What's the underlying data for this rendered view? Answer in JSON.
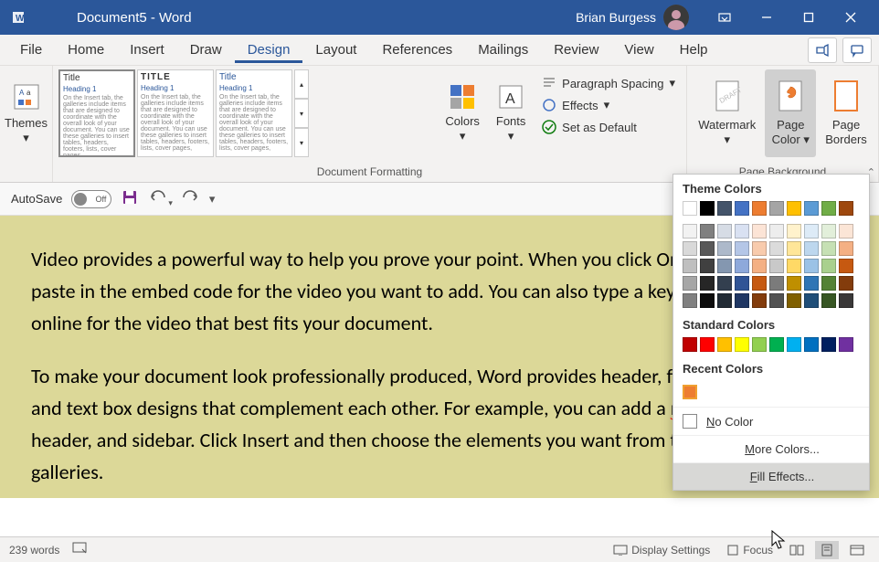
{
  "titlebar": {
    "title": "Document5  -  Word",
    "user": "Brian Burgess"
  },
  "tabs": {
    "items": [
      "File",
      "Home",
      "Insert",
      "Draw",
      "Design",
      "Layout",
      "References",
      "Mailings",
      "Review",
      "View",
      "Help"
    ],
    "active": "Design"
  },
  "ribbon": {
    "themes": "Themes",
    "doc_formatting": "Document Formatting",
    "colors": "Colors",
    "fonts": "Fonts",
    "paragraph_spacing": "Paragraph Spacing",
    "effects": "Effects",
    "set_default": "Set as Default",
    "watermark": "Watermark",
    "page_color": "Page\nColor",
    "page_borders": "Page\nBorders",
    "page_bg_group": "Page Background",
    "style_thumbs": [
      {
        "title": "Title",
        "heading": "Heading 1"
      },
      {
        "title": "TITLE",
        "heading": "Heading 1"
      },
      {
        "title": "Title",
        "heading": "Heading 1"
      }
    ],
    "thumb_body": "On the Insert tab, the galleries include items that are designed to coordinate with the overall look of your document. You can use these galleries to insert tables, headers, footers, lists, cover pages,"
  },
  "qat": {
    "autosave": "AutoSave",
    "autosave_state": "Off"
  },
  "document": {
    "p1": "Video provides a powerful way to help you prove your point. When you click Online Video, you can paste in the embed code for the video you want to add. You can also type a keyword to search online for the video that best fits your document.",
    "p2_a": "To make your document look professionally produced, Word provides header, footer, cover page, and text box designs that complement each other. For example, you can add a ",
    "p2_sq": "matchg",
    "p2_b": " cover page, header, and sidebar. Click Insert and then choose the elements you want from the different galleries."
  },
  "color_dropdown": {
    "theme_label": "Theme Colors",
    "standard_label": "Standard Colors",
    "recent_label": "Recent Colors",
    "no_color": "No Color",
    "more_colors": "More Colors...",
    "fill_effects": "Fill Effects...",
    "theme_row1": [
      "#ffffff",
      "#000000",
      "#44546a",
      "#4472c4",
      "#ed7d31",
      "#a5a5a5",
      "#ffc000",
      "#5b9bd5",
      "#70ad47",
      "#9e480e"
    ],
    "theme_shades": [
      [
        "#f2f2f2",
        "#808080",
        "#d6dce5",
        "#d9e1f2",
        "#fce4d6",
        "#ededed",
        "#fff2cc",
        "#ddebf7",
        "#e2efda",
        "#fbe5d6"
      ],
      [
        "#d9d9d9",
        "#595959",
        "#adb9ca",
        "#b4c6e7",
        "#f8cbad",
        "#dbdbdb",
        "#ffe699",
        "#bdd7ee",
        "#c6e0b4",
        "#f4b084"
      ],
      [
        "#bfbfbf",
        "#404040",
        "#8497b0",
        "#8ea9db",
        "#f4b084",
        "#c9c9c9",
        "#ffd966",
        "#9bc2e6",
        "#a9d08e",
        "#c65911"
      ],
      [
        "#a6a6a6",
        "#262626",
        "#333f4f",
        "#305496",
        "#c65911",
        "#7b7b7b",
        "#bf8f00",
        "#2f75b5",
        "#548235",
        "#833c0c"
      ],
      [
        "#808080",
        "#0d0d0d",
        "#222b35",
        "#203764",
        "#833c0c",
        "#525252",
        "#806000",
        "#1f4e78",
        "#375623",
        "#3a3838"
      ]
    ],
    "standard": [
      "#c00000",
      "#ff0000",
      "#ffc000",
      "#ffff00",
      "#92d050",
      "#00b050",
      "#00b0f0",
      "#0070c0",
      "#002060",
      "#7030a0"
    ],
    "recent": [
      "#ed7d31"
    ]
  },
  "statusbar": {
    "words": "239 words",
    "display_settings": "Display Settings",
    "focus": "Focus"
  }
}
